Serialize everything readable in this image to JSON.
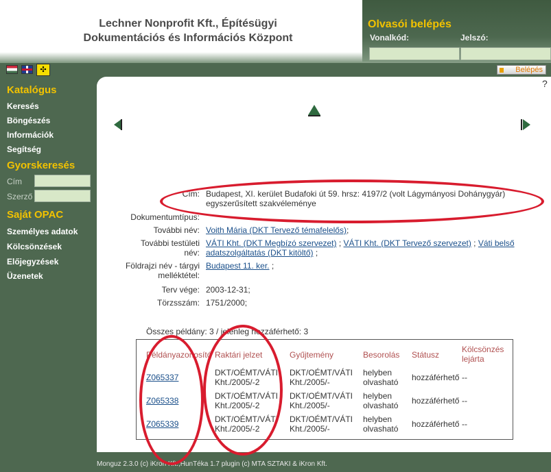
{
  "header": {
    "org_line1": "Lechner Nonprofit Kft., Építésügyi",
    "org_line2": "Dokumentációs és Információs Központ"
  },
  "login": {
    "title": "Olvasói belépés",
    "barcode_label": "Vonalkód:",
    "password_label": "Jelszó:",
    "barcode_value": "",
    "password_value": "",
    "button_label": "Belépés"
  },
  "sidebar": {
    "catalog_head": "Katalógus",
    "catalog_items": [
      "Keresés",
      "Böngészés",
      "Információk",
      "Segítség"
    ],
    "quick_head": "Gyorskeresés",
    "quick_title_label": "Cím",
    "quick_author_label": "Szerző",
    "opac_head": "Saját OPAC",
    "opac_items": [
      "Személyes adatok",
      "Kölcsönzések",
      "Előjegyzések",
      "Üzenetek"
    ]
  },
  "record": {
    "help": "?",
    "title_label": "Cím:",
    "title_line1": "Budapest, XI. kerület Budafoki út 59. hrsz: 4197/2 (volt Lágymányosi Dohánygyár)",
    "title_line2": "egyszerűsített szakvéleménye",
    "doctype_label": "Dokumentumtípus:",
    "doctype_value": "",
    "more_name_label": "További név:",
    "more_name_value": "Voith Mária (DKT Tervező témafelelős)",
    "more_corp_label_line1": "További testületi",
    "more_corp_label_line2": "név:",
    "more_corp_v1": "VÁTI Kht. (DKT Megbízó szervezet)",
    "more_corp_v2": "VÁTI Kht. (DKT Tervező szervezet)",
    "more_corp_v3_line1": "Váti belső",
    "more_corp_v3_line2": "adatszolgáltatás (DKT kitöltő)",
    "geo_label_line1": "Földrajzi név - tárgyi",
    "geo_label_line2": "melléktétel:",
    "geo_value": "Budapest 11. ker.",
    "plan_end_label": "Terv vége:",
    "plan_end_value": "2003-12-31;",
    "reg_label": "Törzsszám:",
    "reg_value": "1751/2000;",
    "sep": ";"
  },
  "holdings": {
    "summary": "Összes példány: 3 / jelenleg hozzáférhető: 3",
    "headers": [
      "Példányazonosító",
      "Raktári jelzet",
      "Gyűjtemény",
      "Besorolás",
      "Státusz",
      "Kölcsönzés",
      "lejárta"
    ],
    "rows": [
      {
        "id": "Z065337",
        "call1": "DKT/OÉMT/VÁTI",
        "call2": "Kht./2005/-2",
        "coll1": "DKT/OÉMT/VÁTI",
        "coll2": "Kht./2005/-",
        "class1": "helyben",
        "class2": "olvasható",
        "status": "hozzáférhető",
        "due": "--"
      },
      {
        "id": "Z065338",
        "call1": "DKT/OÉMT/VÁTI",
        "call2": "Kht./2005/-2",
        "coll1": "DKT/OÉMT/VÁTI",
        "coll2": "Kht./2005/-",
        "class1": "helyben",
        "class2": "olvasható",
        "status": "hozzáférhető",
        "due": "--"
      },
      {
        "id": "Z065339",
        "call1": "DKT/OÉMT/VÁTI",
        "call2": "Kht./2005/-2",
        "coll1": "DKT/OÉMT/VÁTI",
        "coll2": "Kht./2005/-",
        "class1": "helyben",
        "class2": "olvasható",
        "status": "hozzáférhető",
        "due": "--"
      }
    ]
  },
  "footer": {
    "text": "Monguz 2.3.0 (c) iKron Kft.,HunTéka 1.7 plugin (c) MTA SZTAKI & iKron Kft."
  },
  "colors": {
    "accent": "#f2c200",
    "sidebar_bg": "#4e6850",
    "link": "#1a4f8a",
    "annotation": "#d81c2e"
  }
}
